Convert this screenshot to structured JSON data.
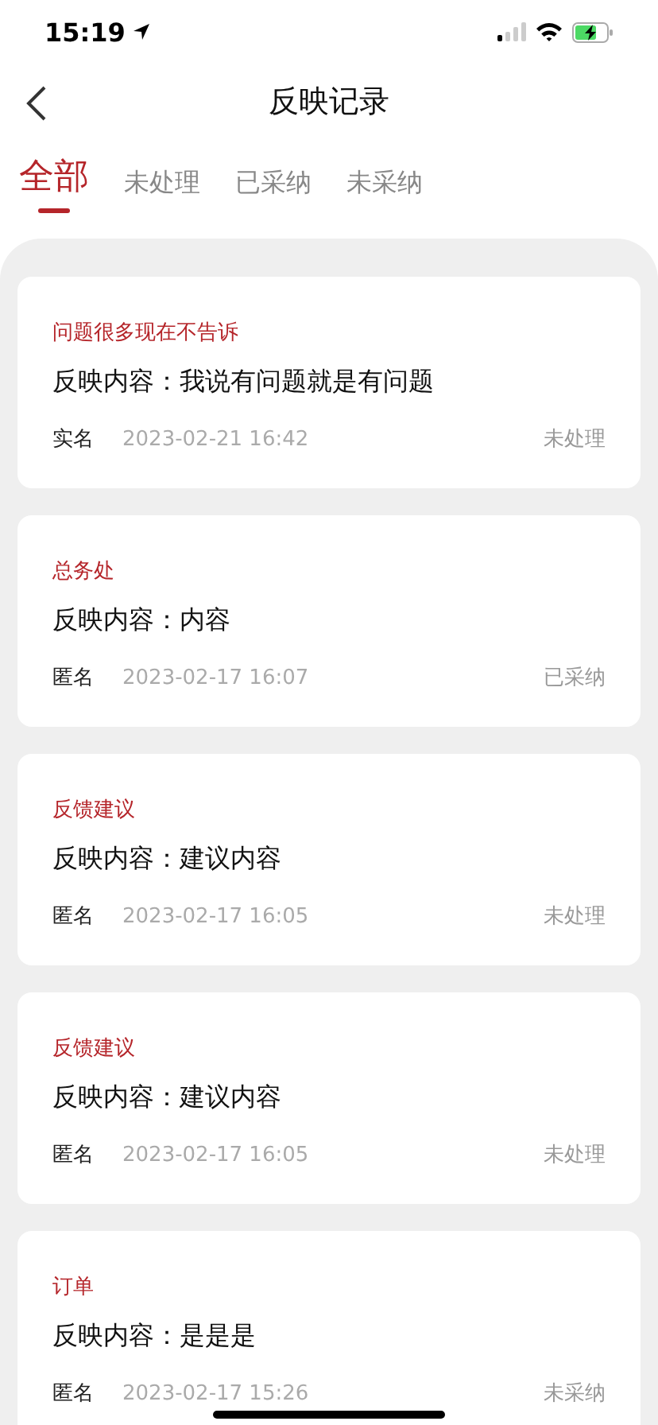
{
  "status_bar": {
    "time": "15:19"
  },
  "nav": {
    "title": "反映记录"
  },
  "tabs": [
    {
      "label": "全部",
      "selected": true
    },
    {
      "label": "未处理",
      "selected": false
    },
    {
      "label": "已采纳",
      "selected": false
    },
    {
      "label": "未采纳",
      "selected": false
    }
  ],
  "records": [
    {
      "category": "问题很多现在不告诉",
      "content": "反映内容：我说有问题就是有问题",
      "identity": "实名",
      "time": "2023-02-21 16:42",
      "status": "未处理"
    },
    {
      "category": "总务处",
      "content": "反映内容：内容",
      "identity": "匿名",
      "time": "2023-02-17 16:07",
      "status": "已采纳"
    },
    {
      "category": "反馈建议",
      "content": "反映内容：建议内容",
      "identity": "匿名",
      "time": "2023-02-17 16:05",
      "status": "未处理"
    },
    {
      "category": "反馈建议",
      "content": "反映内容：建议内容",
      "identity": "匿名",
      "time": "2023-02-17 16:05",
      "status": "未处理"
    },
    {
      "category": "订单",
      "content": "反映内容：是是是",
      "identity": "匿名",
      "time": "2023-02-17 15:26",
      "status": "未采纳"
    }
  ]
}
